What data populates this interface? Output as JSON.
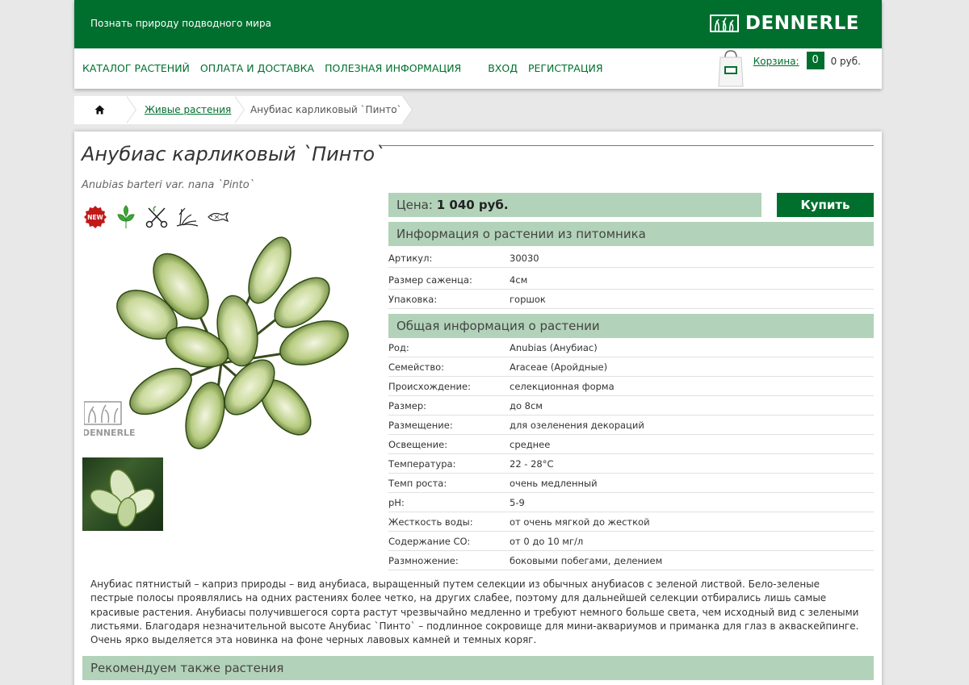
{
  "header": {
    "slogan": "Познать природу подводного мира",
    "logo_text": "DENNERLE"
  },
  "nav": {
    "items": [
      "КАТАЛОГ РАСТЕНИЙ",
      "ОПЛАТА И ДОСТАВКА",
      "ПОЛЕЗНАЯ ИНФОРМАЦИЯ"
    ],
    "login": "ВХОД",
    "register": "РЕГИСТРАЦИЯ",
    "cart_label": "Корзина:",
    "cart_count": "0",
    "cart_sum": "0 руб."
  },
  "breadcrumb": {
    "home_icon": "home-icon",
    "category": "Живые растения",
    "current": "Анубиас карликовый `Пинто`"
  },
  "product": {
    "title": "Анубиас карликовый `Пинто`",
    "latin": "Anubias barteri var. nana `Pinto`",
    "badges": [
      "new-badge-icon",
      "leaf-icon",
      "scissors-icon",
      "planting-icon",
      "fish-icon"
    ],
    "new_badge_text": "NEW",
    "photo_watermark": "DENNERLE",
    "price_label": "Цена:",
    "price_value": "1 040 руб.",
    "buy_label": "Купить"
  },
  "nursery": {
    "title": "Информация о растении из питомника",
    "rows": [
      {
        "k": "Артикул:",
        "v": " 30030"
      },
      {
        "k": "Размер саженца:",
        "v": "4см"
      },
      {
        "k": "Упаковка:",
        "v": "горшок"
      }
    ]
  },
  "general": {
    "title": "Общая информация о растении",
    "rows": [
      {
        "k": "Род:",
        "v": "Anubias (Анубиас)"
      },
      {
        "k": "Семейство:",
        "v": "Araceae (Аройдные)"
      },
      {
        "k": "Происхождение:",
        "v": "селекционная форма"
      },
      {
        "k": "Размер:",
        "v": "до 8см"
      },
      {
        "k": "Размещение:",
        "v": "для озеленения декораций"
      },
      {
        "k": "Освещение:",
        "v": "среднее"
      },
      {
        "k": "Температура:",
        "v": "22 - 28°C"
      },
      {
        "k": "Темп роста:",
        "v": "очень медленный"
      },
      {
        "k": "pH:",
        "v": "5-9"
      },
      {
        "k": "Жесткость воды:",
        "v": "от очень мягкой до жесткой"
      },
      {
        "k": "Содержание CO:",
        "v": "от 0 до 10 мг/л"
      },
      {
        "k": "Размножение:",
        "v": "боковыми побегами, делением"
      }
    ]
  },
  "description": "Анубиас пятнистый – каприз природы – вид анубиаса, выращенный путем селекции из обычных анубиасов с зеленой листвой. Бело-зеленые пестрые полосы проявлялись на одних растениях более четко, на других слабее, поэтому для дальнейшей селекции отбирались лишь самые красивые растения. Анубиасы получившегося сорта растут чрезвычайно медленно и требуют немного больше света, чем исходный вид с зелеными листьями. Благодаря незначительной высоте Анубиас `Пинто` – подлинное сокровище для мини-аквариумов и приманка для глаз в акваскейпинге. Очень ярко выделяется эта новинка на фоне черных лавовых камней и темных коряг.",
  "recommend_title": "Рекомендуем также растения",
  "colors": {
    "brand_green": "#006f2e",
    "section_bg": "#b2d3b9"
  }
}
